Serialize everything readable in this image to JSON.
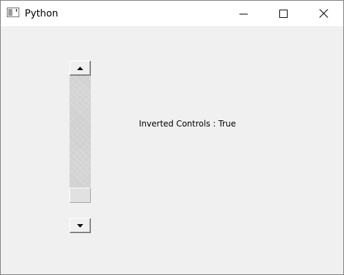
{
  "window": {
    "title": "Python",
    "icon": "app-window-icon",
    "controls": {
      "minimize_icon": "minimize-icon",
      "maximize_icon": "maximize-icon",
      "close_icon": "close-icon"
    }
  },
  "scrollbar": {
    "orientation": "vertical",
    "inverted_controls": true,
    "value_fraction": 1.0,
    "up_icon": "arrow-up-icon",
    "down_icon": "arrow-down-icon"
  },
  "label": {
    "text": "Inverted Controls : True"
  },
  "colors": {
    "window_background": "#f0f0f0",
    "titlebar_background": "#ffffff",
    "border": "#7a7a7a"
  }
}
